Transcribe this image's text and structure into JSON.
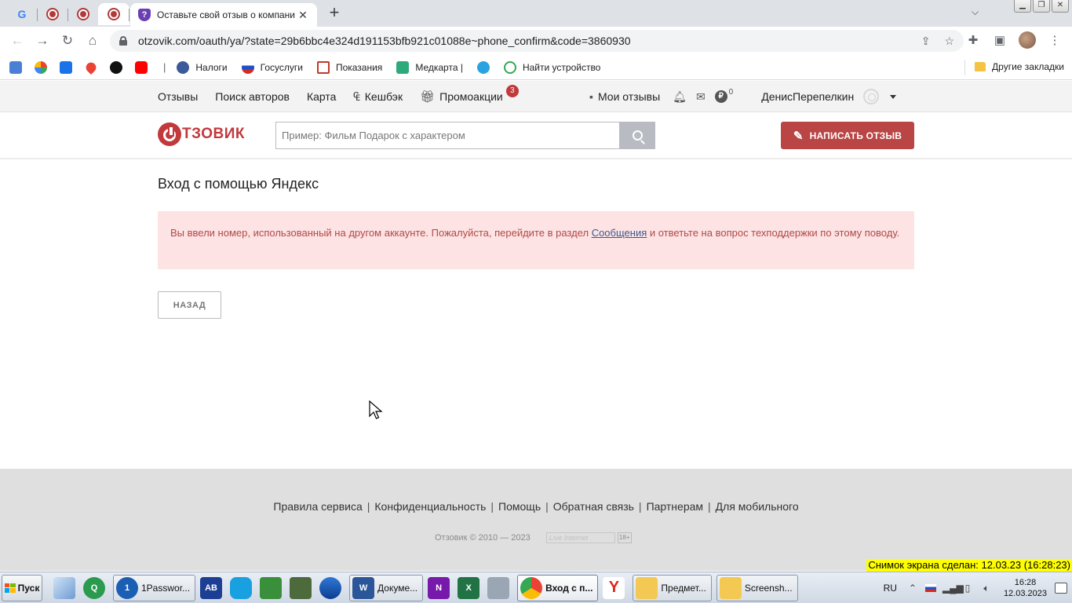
{
  "browser": {
    "active_tab_title": "Оставьте свой отзыв о компани",
    "url": "otzovik.com/oauth/ya/?state=29b6bbc4e324d191153bfb921c01088e~phone_confirm&code=3860930",
    "bookmarks": [
      {
        "label": "Налоги",
        "icon": "tax-icon",
        "color": "#3c5a99"
      },
      {
        "label": "Госуслуги",
        "icon": "gosuslugi-icon",
        "color": "#d52b1e"
      },
      {
        "label": "Показания",
        "icon": "meter-icon",
        "color": "#c0392b"
      },
      {
        "label": "Медкарта |",
        "icon": "medcard-icon",
        "color": "#2eaa7a"
      },
      {
        "label": "Найти устройство",
        "icon": "find-device-icon",
        "color": "#34a853"
      }
    ],
    "other_bookmarks": "Другие закладки"
  },
  "site": {
    "nav": {
      "reviews": "Отзывы",
      "authors": "Поиск авторов",
      "map": "Карта",
      "cashback": "Кешбэк",
      "promo": "Промоакции",
      "promo_count": "3",
      "my_reviews": "Мои отзывы",
      "points": "0",
      "username": "ДенисПерепелкин"
    },
    "logo_text": "ТЗОВИК",
    "search_placeholder": "Пример: Фильм Подарок с характером",
    "write_review": "НАПИСАТЬ ОТЗЫВ"
  },
  "main": {
    "title": "Вход с помощью Яндекс",
    "alert_before": "Вы ввели номер, использованный на другом аккаунте. Пожалуйста, перейдите в раздел ",
    "alert_link": "Сообщения",
    "alert_after": " и ответьте на вопрос техподдержки по этому поводу.",
    "back_button": "НАЗАД"
  },
  "footer": {
    "links": [
      "Правила сервиса",
      "Конфиденциальность",
      "Помощь",
      "Обратная связь",
      "Партнерам",
      "Для мобильного"
    ],
    "copyright": "Отзовик © 2010 — 2023",
    "counter": "Live Internet",
    "age": "18+"
  },
  "stamp": "Снимок экрана сделан: 12.03.23 (16:28:23)",
  "taskbar": {
    "start": "Пуск",
    "apps": [
      {
        "label": "1Passwor...",
        "name": "taskbar-1password"
      },
      {
        "label": "Докуме...",
        "name": "taskbar-word"
      },
      {
        "label": "Вход с п...",
        "name": "taskbar-chrome"
      },
      {
        "label": "Предмет...",
        "name": "taskbar-folder-1"
      },
      {
        "label": "Screensh...",
        "name": "taskbar-folder-2"
      }
    ],
    "lang": "RU",
    "time": "16:28",
    "date": "12.03.2023"
  }
}
